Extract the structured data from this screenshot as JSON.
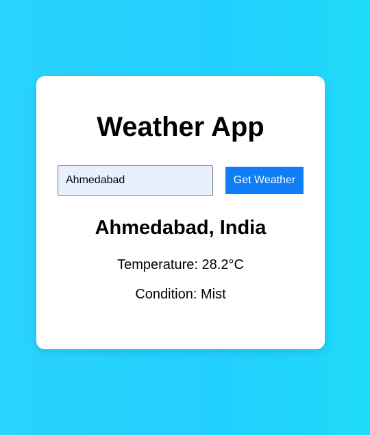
{
  "app": {
    "title": "Weather App"
  },
  "search": {
    "value": "Ahmedabad",
    "button_label": "Get Weather"
  },
  "result": {
    "location": "Ahmedabad, India",
    "temperature_label": "Temperature:",
    "temperature_value": "28.2°C",
    "condition_label": "Condition:",
    "condition_value": "Mist"
  },
  "colors": {
    "background": "#22d0fe",
    "card": "#ffffff",
    "button": "#0d7ef7",
    "input_fill": "#e8f0fe"
  }
}
